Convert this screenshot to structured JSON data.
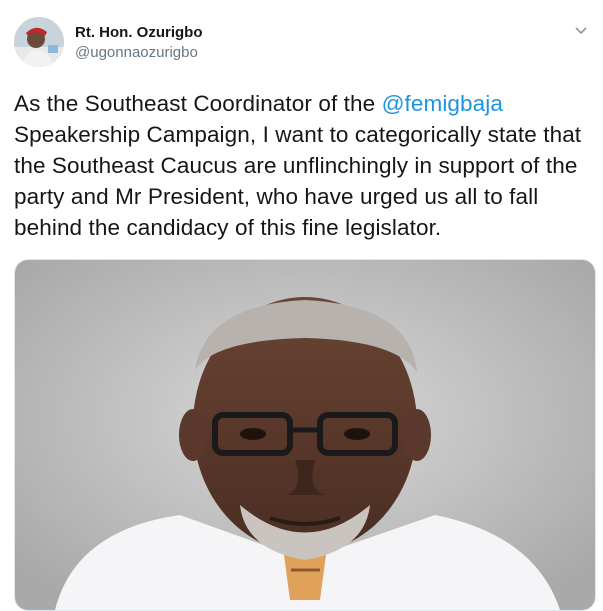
{
  "tweet": {
    "author": {
      "display_name": "Rt. Hon. Ozurigbo",
      "handle": "@ugonnaozurigbo",
      "avatar_icon": "profile-avatar"
    },
    "menu_icon": "chevron-down-icon",
    "text": {
      "part1": "As the Southeast Coordinator of the ",
      "mention": "@femigbaja",
      "part2": " Speakership Campaign, I want to categorically state that the Southeast Caucus are unflinchingly in support of the party and Mr President, who have urged us all to fall behind the candidacy of this fine legislator."
    },
    "media": {
      "type": "photo",
      "description_icon": "portrait-photo"
    }
  },
  "colors": {
    "text_primary": "#14171a",
    "text_secondary": "#657786",
    "link": "#1b95e0",
    "border": "#e1e8ed"
  }
}
